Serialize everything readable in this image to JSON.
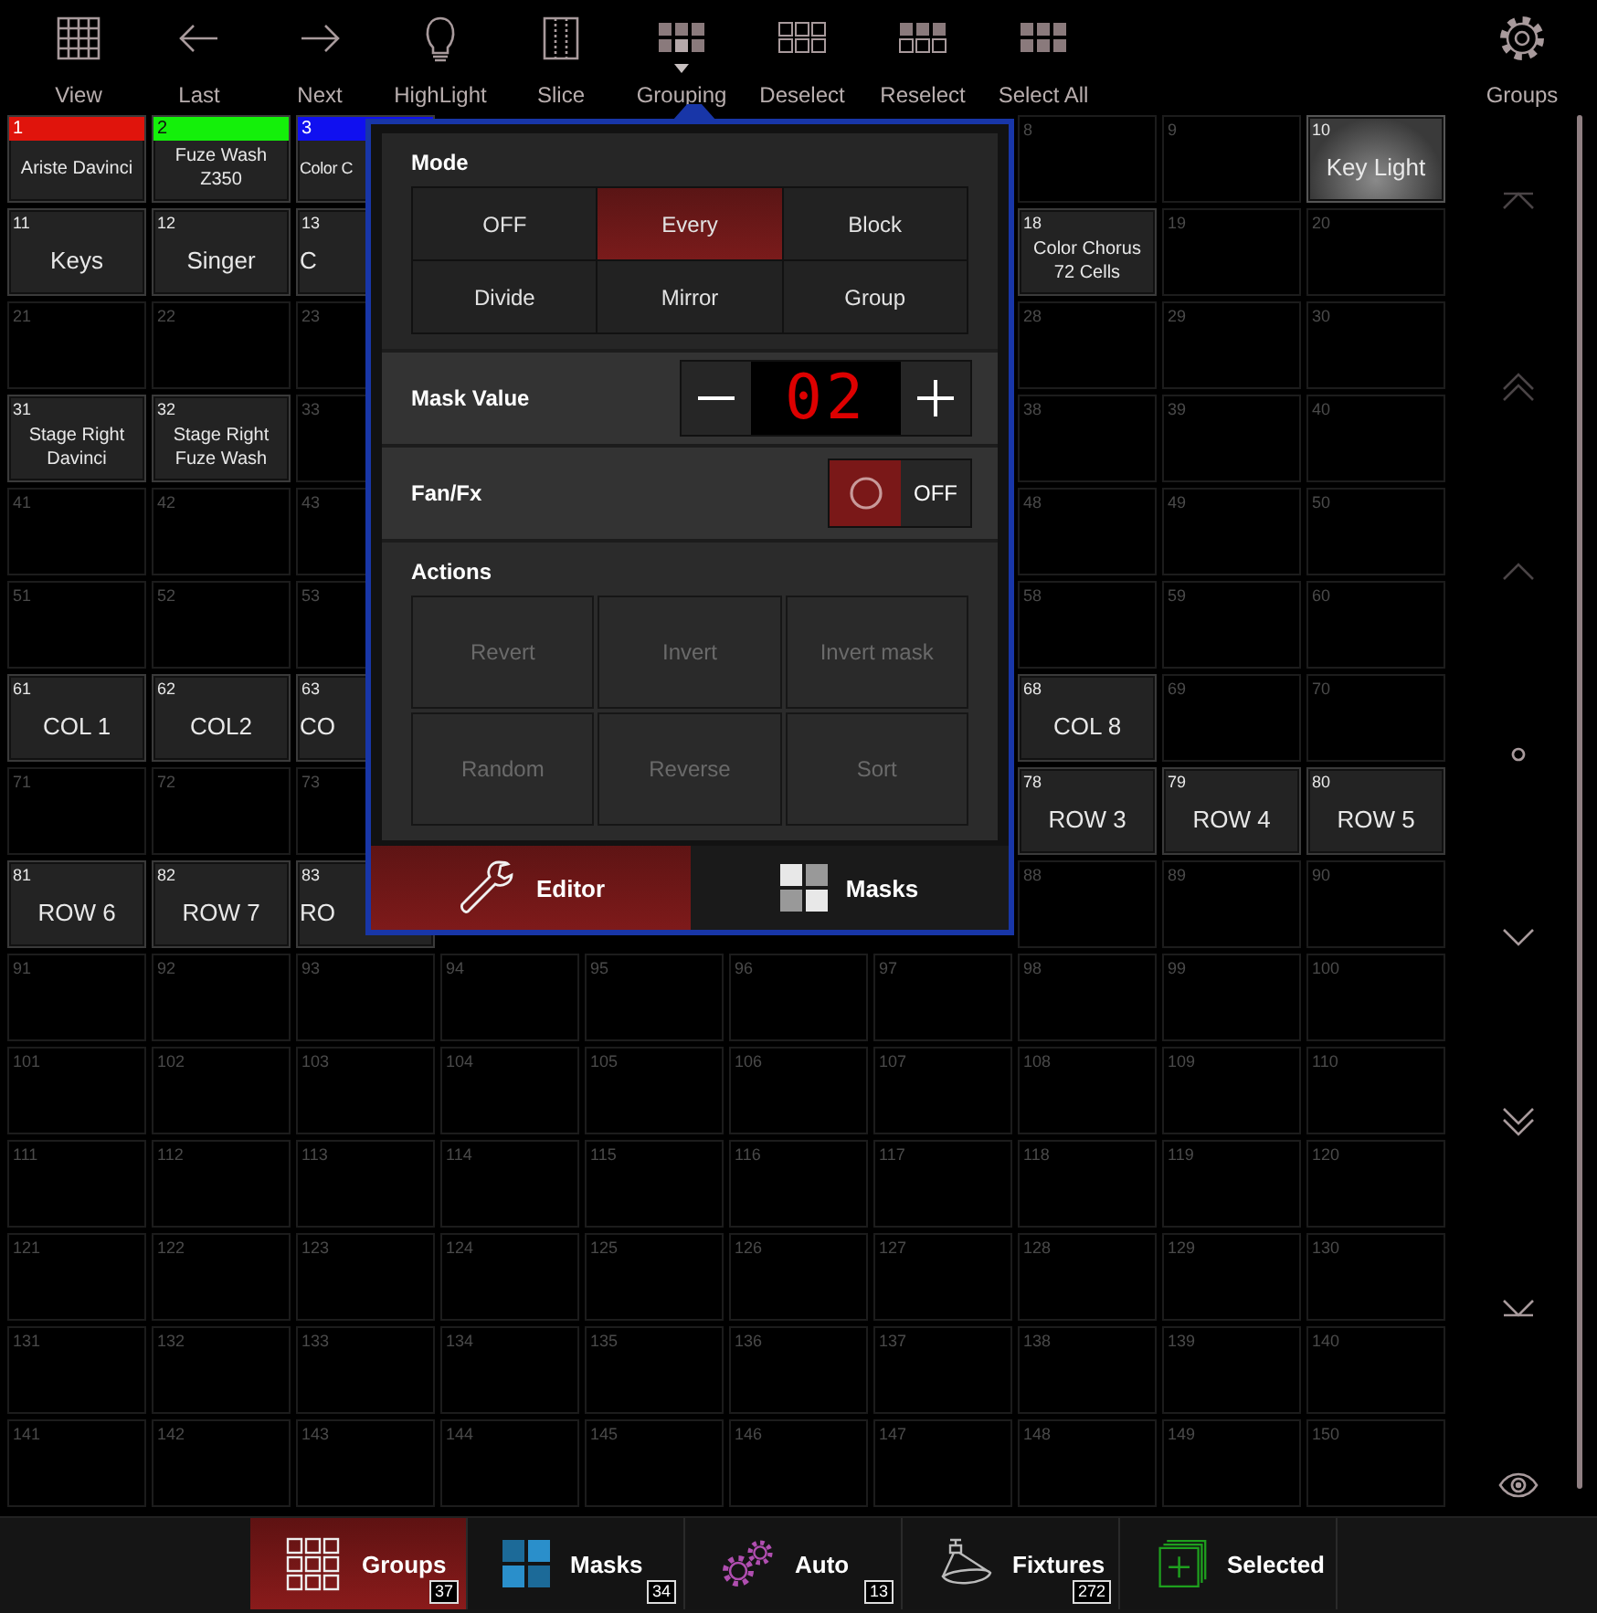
{
  "toolbar": {
    "items": [
      {
        "kind": "grid",
        "label": "View",
        "selected": false
      },
      {
        "kind": "arrow-left",
        "label": "Last",
        "selected": false
      },
      {
        "kind": "arrow-right",
        "label": "Next",
        "selected": false
      },
      {
        "kind": "bulb",
        "label": "HighLight",
        "selected": false
      },
      {
        "kind": "slice",
        "label": "Slice",
        "selected": false
      },
      {
        "kind": "grouping",
        "label": "Grouping",
        "selected": true
      },
      {
        "kind": "deselect",
        "label": "Deselect",
        "selected": false
      },
      {
        "kind": "reselect",
        "label": "Reselect",
        "selected": false
      },
      {
        "kind": "select-all",
        "label": "Select All",
        "selected": false
      }
    ],
    "settings": {
      "label": "Groups"
    }
  },
  "grid": {
    "rows": [
      {
        "left": [
          {
            "number": "1",
            "label": "Ariste Davinci",
            "color": "#e0140c",
            "selected": false
          },
          {
            "number": "2",
            "label": "Fuze Wash Z350",
            "color": "#14f00a",
            "selected": false
          },
          {
            "number": "3",
            "label": "Color C",
            "color": "#1010f0",
            "selected": false
          }
        ],
        "right": [
          {
            "number": "8",
            "selected": false
          },
          {
            "number": "9",
            "selected": false
          },
          {
            "number": "10",
            "label": "Key Light",
            "selected": true
          }
        ]
      },
      {
        "left": [
          {
            "number": "11",
            "label": "Keys",
            "selected": false
          },
          {
            "number": "12",
            "label": "Singer",
            "selected": false
          },
          {
            "number": "13",
            "label": "C",
            "selected": false
          }
        ],
        "right": [
          {
            "number": "18",
            "label": "Color Chorus 72 Cells",
            "selected": false
          },
          {
            "number": "19",
            "selected": false
          },
          {
            "number": "20",
            "selected": false
          }
        ]
      },
      {
        "left": [
          {
            "number": "21",
            "selected": false
          },
          {
            "number": "22",
            "selected": false
          },
          {
            "number": "23",
            "selected": false
          }
        ],
        "right": [
          {
            "number": "28",
            "selected": false
          },
          {
            "number": "29",
            "selected": false
          },
          {
            "number": "30",
            "selected": false
          }
        ]
      },
      {
        "left": [
          {
            "number": "31",
            "label": "Stage Right Davinci",
            "selected": false
          },
          {
            "number": "32",
            "label": "Stage Right Fuze Wash",
            "selected": false
          },
          {
            "number": "33",
            "selected": false
          }
        ],
        "right": [
          {
            "number": "38",
            "selected": false
          },
          {
            "number": "39",
            "selected": false
          },
          {
            "number": "40",
            "selected": false
          }
        ]
      },
      {
        "left": [
          {
            "number": "41",
            "selected": false
          },
          {
            "number": "42",
            "selected": false
          },
          {
            "number": "43",
            "selected": false
          }
        ],
        "right": [
          {
            "number": "48",
            "selected": false
          },
          {
            "number": "49",
            "selected": false
          },
          {
            "number": "50",
            "selected": false
          }
        ]
      },
      {
        "left": [
          {
            "number": "51",
            "selected": false
          },
          {
            "number": "52",
            "selected": false
          },
          {
            "number": "53",
            "selected": false
          }
        ],
        "right": [
          {
            "number": "58",
            "selected": false
          },
          {
            "number": "59",
            "selected": false
          },
          {
            "number": "60",
            "selected": false
          }
        ]
      },
      {
        "left": [
          {
            "number": "61",
            "label": "COL 1",
            "selected": false
          },
          {
            "number": "62",
            "label": "COL2",
            "selected": false
          },
          {
            "number": "63",
            "label": "CO",
            "selected": false
          }
        ],
        "right": [
          {
            "number": "68",
            "label": "COL 8",
            "selected": false
          },
          {
            "number": "69",
            "selected": false
          },
          {
            "number": "70",
            "selected": false
          }
        ]
      },
      {
        "left": [
          {
            "number": "71",
            "selected": false
          },
          {
            "number": "72",
            "selected": false
          },
          {
            "number": "73",
            "selected": false
          }
        ],
        "right": [
          {
            "number": "78",
            "label": "ROW 3",
            "selected": false
          },
          {
            "number": "79",
            "label": "ROW 4",
            "selected": false
          },
          {
            "number": "80",
            "label": "ROW 5",
            "selected": false
          }
        ]
      },
      {
        "left": [
          {
            "number": "81",
            "label": "ROW 6",
            "selected": false
          },
          {
            "number": "82",
            "label": "ROW 7",
            "selected": false
          },
          {
            "number": "83",
            "label": "RO",
            "selected": false
          }
        ],
        "right": [
          {
            "number": "88",
            "selected": false
          },
          {
            "number": "89",
            "selected": false
          },
          {
            "number": "90",
            "selected": false
          }
        ]
      },
      {
        "cells": [
          {
            "number": "91",
            "selected": false
          },
          {
            "number": "92",
            "selected": false
          },
          {
            "number": "93",
            "selected": false
          },
          {
            "number": "94",
            "selected": false
          },
          {
            "number": "95",
            "selected": false
          },
          {
            "number": "96",
            "selected": false
          },
          {
            "number": "97",
            "selected": false
          },
          {
            "number": "98",
            "selected": false
          },
          {
            "number": "99",
            "selected": false
          },
          {
            "number": "100",
            "selected": false
          }
        ]
      },
      {
        "cells": [
          {
            "number": "101",
            "selected": false
          },
          {
            "number": "102",
            "selected": false
          },
          {
            "number": "103",
            "selected": false
          },
          {
            "number": "104",
            "selected": false
          },
          {
            "number": "105",
            "selected": false
          },
          {
            "number": "106",
            "selected": false
          },
          {
            "number": "107",
            "selected": false
          },
          {
            "number": "108",
            "selected": false
          },
          {
            "number": "109",
            "selected": false
          },
          {
            "number": "110",
            "selected": false
          }
        ]
      },
      {
        "cells": [
          {
            "number": "111",
            "selected": false
          },
          {
            "number": "112",
            "selected": false
          },
          {
            "number": "113",
            "selected": false
          },
          {
            "number": "114",
            "selected": false
          },
          {
            "number": "115",
            "selected": false
          },
          {
            "number": "116",
            "selected": false
          },
          {
            "number": "117",
            "selected": false
          },
          {
            "number": "118",
            "selected": false
          },
          {
            "number": "119",
            "selected": false
          },
          {
            "number": "120",
            "selected": false
          }
        ]
      },
      {
        "cells": [
          {
            "number": "121",
            "selected": false
          },
          {
            "number": "122",
            "selected": false
          },
          {
            "number": "123",
            "selected": false
          },
          {
            "number": "124",
            "selected": false
          },
          {
            "number": "125",
            "selected": false
          },
          {
            "number": "126",
            "selected": false
          },
          {
            "number": "127",
            "selected": false
          },
          {
            "number": "128",
            "selected": false
          },
          {
            "number": "129",
            "selected": false
          },
          {
            "number": "130",
            "selected": false
          }
        ]
      },
      {
        "cells": [
          {
            "number": "131",
            "selected": false
          },
          {
            "number": "132",
            "selected": false
          },
          {
            "number": "133",
            "selected": false
          },
          {
            "number": "134",
            "selected": false
          },
          {
            "number": "135",
            "selected": false
          },
          {
            "number": "136",
            "selected": false
          },
          {
            "number": "137",
            "selected": false
          },
          {
            "number": "138",
            "selected": false
          },
          {
            "number": "139",
            "selected": false
          },
          {
            "number": "140",
            "selected": false
          }
        ]
      },
      {
        "cells": [
          {
            "number": "141",
            "selected": false
          },
          {
            "number": "142",
            "selected": false
          },
          {
            "number": "143",
            "selected": false
          },
          {
            "number": "144",
            "selected": false
          },
          {
            "number": "145",
            "selected": false
          },
          {
            "number": "146",
            "selected": false
          },
          {
            "number": "147",
            "selected": false
          },
          {
            "number": "148",
            "selected": false
          },
          {
            "number": "149",
            "selected": false
          },
          {
            "number": "150",
            "selected": false
          }
        ]
      }
    ]
  },
  "scroll_controls": [
    {
      "kind": "top",
      "disabled": true
    },
    {
      "kind": "page-up",
      "disabled": true
    },
    {
      "kind": "up",
      "disabled": true
    },
    {
      "kind": "center",
      "disabled": false
    },
    {
      "kind": "down",
      "disabled": false
    },
    {
      "kind": "page-down",
      "disabled": false
    },
    {
      "kind": "bottom",
      "disabled": false
    },
    {
      "kind": "eye",
      "disabled": false
    }
  ],
  "mask_popup": {
    "mode": {
      "title": "Mode",
      "options": [
        {
          "label": "OFF",
          "selected": false
        },
        {
          "label": "Every",
          "selected": true
        },
        {
          "label": "Block",
          "selected": false
        },
        {
          "label": "Divide",
          "selected": false
        },
        {
          "label": "Mirror",
          "selected": false
        },
        {
          "label": "Group",
          "selected": false
        }
      ]
    },
    "mask_value": {
      "label": "Mask Value",
      "value": "02"
    },
    "fan_fx": {
      "label": "Fan/Fx",
      "value": "OFF",
      "on": false
    },
    "actions": {
      "title": "Actions",
      "buttons": [
        {
          "label": "Revert",
          "disabled": true
        },
        {
          "label": "Invert",
          "disabled": true
        },
        {
          "label": "Invert mask",
          "disabled": true
        },
        {
          "label": "Random",
          "disabled": true
        },
        {
          "label": "Reverse",
          "disabled": true
        },
        {
          "label": "Sort",
          "disabled": true
        }
      ]
    },
    "tabs": [
      {
        "kind": "editor",
        "label": "Editor",
        "selected": true
      },
      {
        "kind": "masks",
        "label": "Masks",
        "selected": false
      }
    ]
  },
  "bottom_tabs": [
    {
      "kind": "groups",
      "label": "Groups",
      "count": "37",
      "selected": true
    },
    {
      "kind": "masks",
      "label": "Masks",
      "count": "34",
      "selected": false
    },
    {
      "kind": "auto",
      "label": "Auto",
      "count": "13",
      "selected": false
    },
    {
      "kind": "fixtures",
      "label": "Fixtures",
      "count": "272",
      "selected": false
    },
    {
      "kind": "selected",
      "label": "Selected",
      "selected": false
    }
  ]
}
